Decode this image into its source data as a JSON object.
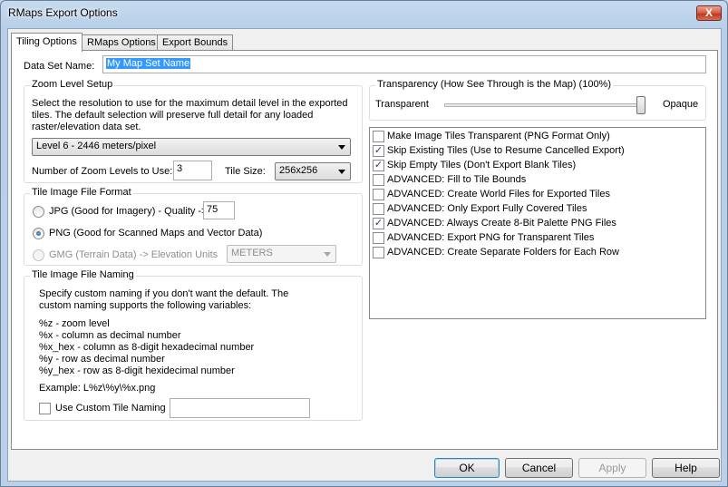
{
  "window": {
    "title": "RMaps Export Options",
    "close_glyph": "X"
  },
  "tabs": [
    {
      "label": "Tiling Options",
      "active": true
    },
    {
      "label": "RMaps Options",
      "active": false
    },
    {
      "label": "Export Bounds",
      "active": false
    }
  ],
  "dataset": {
    "label": "Data Set Name:",
    "value": "My Map Set Name"
  },
  "zoom": {
    "group_title": "Zoom Level Setup",
    "description": "Select the resolution to use for the maximum detail level in the exported tiles. The default selection will preserve full detail for any loaded raster/elevation data set.",
    "resolution_selected": "Level 6 - 2446 meters/pixel",
    "num_levels_label": "Number of Zoom Levels to Use:",
    "num_levels_value": "3",
    "tile_size_label": "Tile Size:",
    "tile_size_selected": "256x256"
  },
  "format": {
    "group_title": "Tile Image File Format",
    "jpg_label": "JPG (Good for Imagery) - Quality ->",
    "jpg_quality": "75",
    "png_label": "PNG (Good for Scanned Maps and Vector Data)",
    "gmg_label": "GMG (Terrain Data) -> Elevation Units",
    "elevation_units": "METERS",
    "selected": "png"
  },
  "naming": {
    "group_title": "Tile Image File Naming",
    "description": "Specify custom naming if you don't want the default. The custom naming supports the following variables:",
    "variables": [
      "%z - zoom level",
      "%x - column as decimal number",
      "%x_hex - column as 8-digit hexadecimal number",
      "%y - row as decimal number",
      "%y_hex - row as 8-digit hexidecimal number"
    ],
    "example": "Example: L%z\\%y\\%x.png",
    "custom_label": "Use Custom Tile Naming",
    "custom_checked": false,
    "custom_value": ""
  },
  "transparency": {
    "group_title": "Transparency (How See Through is the Map) (100%)",
    "left_label": "Transparent",
    "right_label": "Opaque",
    "level_percent": 100
  },
  "options": [
    {
      "label": "Make Image Tiles Transparent (PNG Format Only)",
      "checked": false
    },
    {
      "label": "Skip Existing Tiles (Use to Resume Cancelled Export)",
      "checked": true
    },
    {
      "label": "Skip Empty Tiles (Don't Export Blank Tiles)",
      "checked": true
    },
    {
      "label": "ADVANCED: Fill to Tile Bounds",
      "checked": false
    },
    {
      "label": "ADVANCED: Create World Files for Exported Tiles",
      "checked": false
    },
    {
      "label": "ADVANCED: Only Export Fully Covered Tiles",
      "checked": false
    },
    {
      "label": "ADVANCED: Always Create 8-Bit Palette PNG Files",
      "checked": true
    },
    {
      "label": "ADVANCED: Export PNG for Transparent Tiles",
      "checked": false
    },
    {
      "label": "ADVANCED: Create Separate Folders for Each Row",
      "checked": false
    }
  ],
  "buttons": {
    "ok": "OK",
    "cancel": "Cancel",
    "apply": "Apply",
    "help": "Help"
  },
  "check_glyph": "✓"
}
